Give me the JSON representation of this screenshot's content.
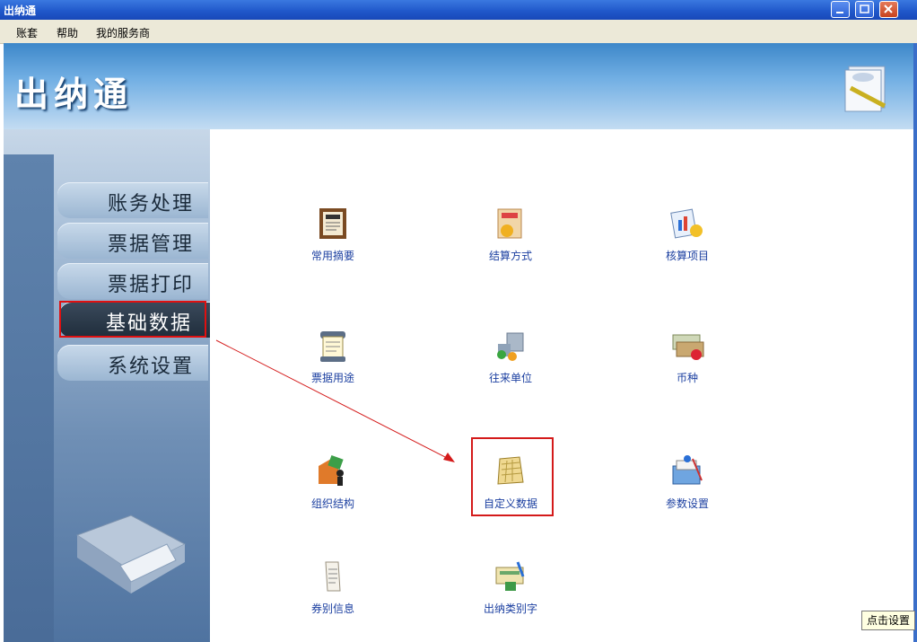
{
  "window": {
    "title": "出纳通"
  },
  "menu": {
    "items": [
      "账套",
      "帮助",
      "我的服务商"
    ]
  },
  "banner": {
    "title": "出纳通"
  },
  "sidebar": {
    "items": [
      {
        "label": "账务处理",
        "active": false
      },
      {
        "label": "票据管理",
        "active": false
      },
      {
        "label": "票据打印",
        "active": false
      },
      {
        "label": "基础数据",
        "active": true
      },
      {
        "label": "系统设置",
        "active": false
      }
    ]
  },
  "tiles": [
    {
      "label": "常用摘要",
      "icon": "summary-book-icon"
    },
    {
      "label": "结算方式",
      "icon": "settlement-icon"
    },
    {
      "label": "核算项目",
      "icon": "accounting-item-icon"
    },
    {
      "label": "票据用途",
      "icon": "bill-usage-icon"
    },
    {
      "label": "往来单位",
      "icon": "partner-unit-icon"
    },
    {
      "label": "币种",
      "icon": "currency-icon"
    },
    {
      "label": "组织结构",
      "icon": "organization-icon"
    },
    {
      "label": "自定义数据",
      "icon": "custom-data-icon"
    },
    {
      "label": "参数设置",
      "icon": "parameter-settings-icon"
    },
    {
      "label": "券别信息",
      "icon": "voucher-type-icon"
    },
    {
      "label": "出纳类别字",
      "icon": "cashier-category-icon"
    }
  ],
  "tooltip": {
    "text": "点击设置"
  },
  "colors": {
    "accent": "#1f56c9",
    "highlight": "#e01010",
    "link": "#1b3fa0"
  }
}
